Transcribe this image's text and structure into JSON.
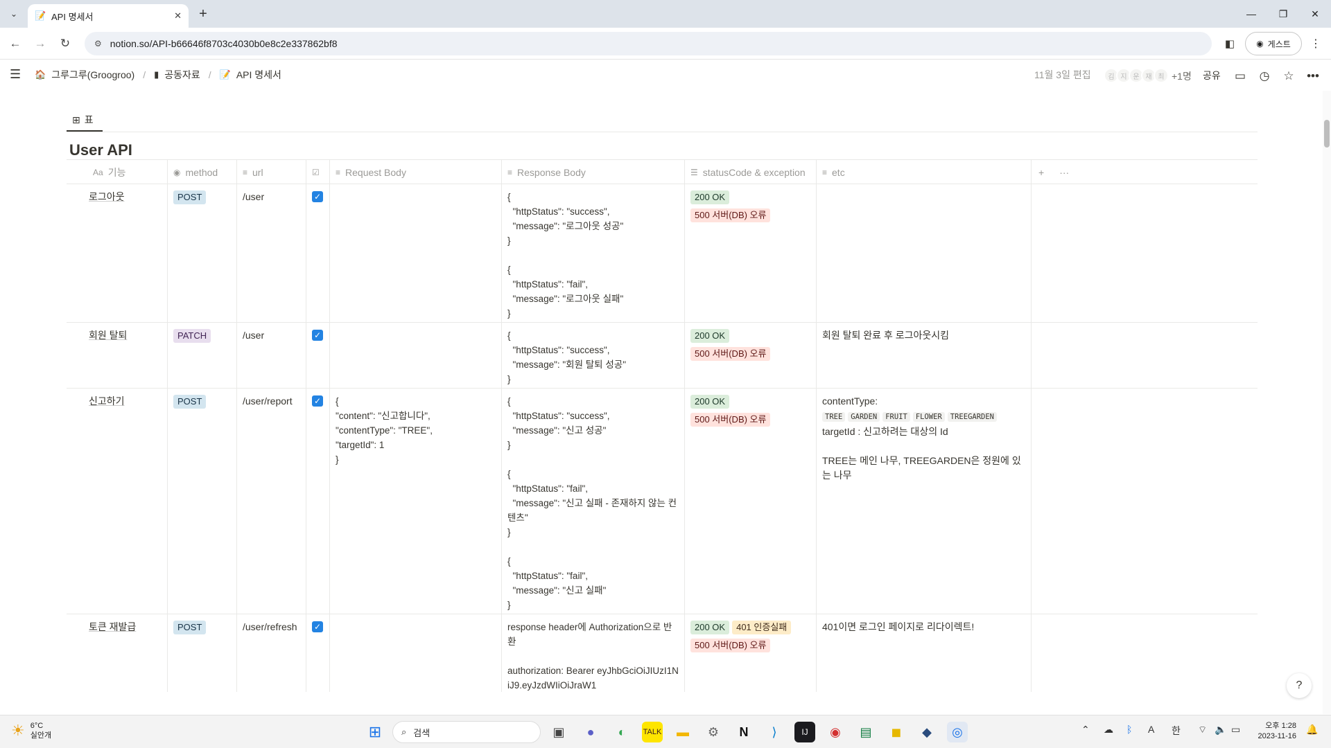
{
  "browser": {
    "tab_title": "API 명세서",
    "url": "notion.so/API-b66646f8703c4030b0e8c2e337862bf8",
    "profile_label": "게스트"
  },
  "notion": {
    "breadcrumb": [
      "그루그루(Groogroo)",
      "공동자료",
      "API 명세서"
    ],
    "edited": "11월 3일 편집",
    "avatars": [
      "김",
      "지",
      "운",
      "재",
      "최"
    ],
    "plus_count": "+1명",
    "share_label": "공유",
    "view_tab_label": "표",
    "db_title": "User API",
    "columns": [
      {
        "label": "기능",
        "icon": "Aa"
      },
      {
        "label": "method",
        "icon": "select-icon"
      },
      {
        "label": "url",
        "icon": "text-icon"
      },
      {
        "label": "",
        "icon": "checkbox-icon"
      },
      {
        "label": "Request Body",
        "icon": "text-icon"
      },
      {
        "label": "Response Body",
        "icon": "text-icon"
      },
      {
        "label": "statusCode & exception",
        "icon": "list-icon"
      },
      {
        "label": "etc",
        "icon": "text-icon"
      }
    ],
    "rows": [
      {
        "name": "로그아웃",
        "method": "POST",
        "url": "/user",
        "checked": true,
        "request": "",
        "response": "{\n  \"httpStatus\": \"success\",\n  \"message\": \"로그아웃 성공\"\n}\n\n{\n  \"httpStatus\": \"fail\",\n  \"message\": \"로그아웃 실패\"\n}",
        "status": [
          "200 OK",
          "500 서버(DB) 오류"
        ],
        "etc": ""
      },
      {
        "name": "회원 탈퇴",
        "method": "PATCH",
        "url": "/user",
        "checked": true,
        "request": "",
        "response": "{\n  \"httpStatus\": \"success\",\n  \"message\": \"회원 탈퇴 성공\"\n}",
        "status": [
          "200 OK",
          "500 서버(DB) 오류"
        ],
        "etc": "회원 탈퇴 완료 후 로그아웃시킴"
      },
      {
        "name": "신고하기",
        "method": "POST",
        "url": "/user/report",
        "checked": true,
        "request": "{\n\"content\": \"신고합니다\",\n\"contentType\": \"TREE\",\n\"targetId\": 1\n}",
        "response": "{\n  \"httpStatus\": \"success\",\n  \"message\": \"신고 성공\"\n}\n\n{\n  \"httpStatus\": \"fail\",\n  \"message\": \"신고 실패 - 존재하지 않는 컨텐츠\"\n}\n\n{\n  \"httpStatus\": \"fail\",\n  \"message\": \"신고 실패\"\n}",
        "status": [
          "200 OK",
          "500 서버(DB) 오류"
        ],
        "etc_prefix": "contentType:",
        "etc_codes": [
          "TREE",
          "GARDEN",
          "FRUIT",
          "FLOWER",
          "TREEGARDEN"
        ],
        "etc_line2": "targetId : 신고하려는 대상의 Id",
        "etc_line3": "TREE는 메인 나무, TREEGARDEN은 정원에 있는 나무"
      },
      {
        "name": "토큰 재발급",
        "method": "POST",
        "url": "/user/refresh",
        "checked": true,
        "request": "",
        "response": "response header에 Authorization으로 반환\n\nauthorization: Bearer eyJhbGciOiJIUzI1NiJ9.eyJzdWIiOiJraW1",
        "status": [
          "200 OK",
          "401 인증실패",
          "500 서버(DB) 오류"
        ],
        "etc": "401이면 로그인 페이지로 리다이렉트!"
      }
    ]
  },
  "taskbar": {
    "weather_temp": "6°C",
    "weather_desc": "실안개",
    "search_label": "검색",
    "ime_label": "한",
    "time": "오후 1:28",
    "date": "2023-11-16"
  }
}
